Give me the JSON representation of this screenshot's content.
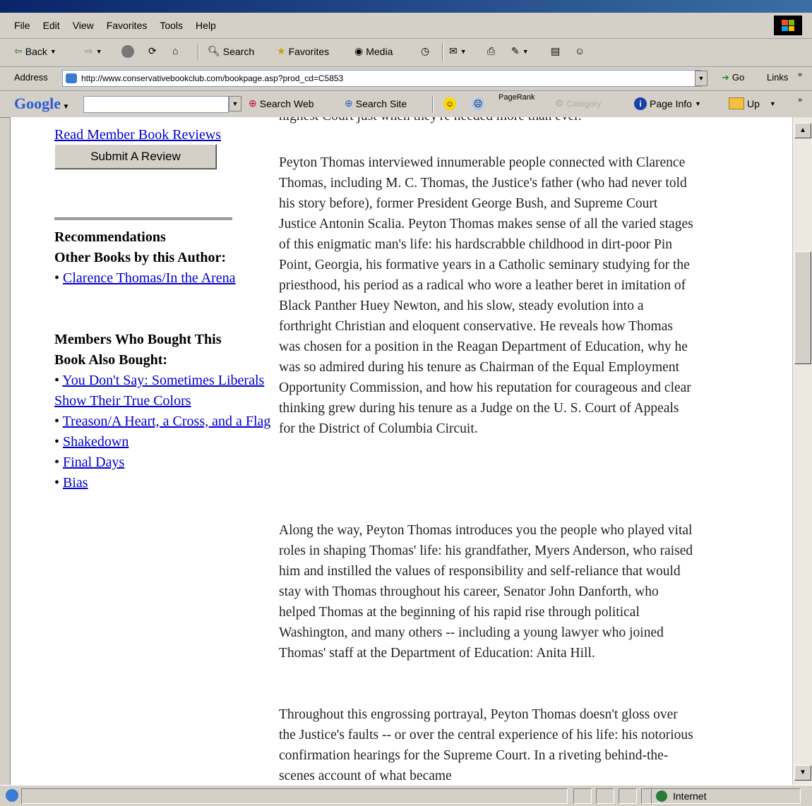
{
  "menu": [
    "File",
    "Edit",
    "View",
    "Favorites",
    "Tools",
    "Help"
  ],
  "toolbar": {
    "back": "Back",
    "search": "Search",
    "favorites": "Favorites",
    "media": "Media"
  },
  "address": {
    "label": "Address",
    "url": "http://www.conservativebookclub.com/bookpage.asp?prod_cd=C5853",
    "go": "Go",
    "links": "Links"
  },
  "google": {
    "logo": "Google",
    "search_web": "Search Web",
    "search_site": "Search Site",
    "pagerank": "PageRank",
    "category": "Category",
    "page_info": "Page Info",
    "up": "Up"
  },
  "sidebar": {
    "read_reviews": "Read Member Book Reviews",
    "submit_review": "Submit A Review",
    "recommendations": "Recommendations",
    "other_books_heading": "Other Books by this Author:",
    "other_books": [
      "Clarence Thomas/In the Arena"
    ],
    "also_bought_heading_1": "Members Who Bought This",
    "also_bought_heading_2": "Book Also Bought:",
    "also_bought": [
      "You Don't Say: Sometimes Liberals Show Their True Colors",
      "Treason/A Heart, a Cross, and a Flag",
      "Shakedown",
      "Final Days",
      "Bias"
    ]
  },
  "main": {
    "top_line": "highest Court just when they're needed more than ever.",
    "para1": "Peyton Thomas interviewed innumerable people connected with Clarence Thomas, including M. C. Thomas, the Justice's father (who had never told his story before), former President George Bush, and Supreme Court Justice Antonin Scalia. Peyton Thomas makes sense of all the varied stages of this enigmatic man's life: his hardscrabble childhood in dirt-poor Pin Point, Georgia, his formative years in a Catholic seminary studying for the priesthood, his period as a radical who wore a leather beret in imitation of Black Panther Huey Newton, and his slow, steady evolution into a forthright Christian and eloquent conservative. He reveals how Thomas was chosen for a position in the Reagan Department of Education, why he was so admired during his tenure as Chairman of the Equal Employment Opportunity Commission, and how his reputation for courageous and clear thinking grew during his tenure as a Judge on the U. S. Court of Appeals for the District of Columbia Circuit.",
    "para2": "Along the way, Peyton Thomas introduces you the people who played vital roles in shaping Thomas' life: his grandfather, Myers Anderson, who raised him and instilled the values of responsibility and self-reliance that would stay with Thomas throughout his career, Senator John Danforth, who helped Thomas at the beginning of his rapid rise through political Washington, and many others -- including a young lawyer who joined Thomas' staff at the Department of Education: Anita Hill.",
    "para3": "Throughout this engrossing portrayal, Peyton Thomas doesn't gloss over the Justice's faults -- or over the central experience of his life: his notorious confirmation hearings for the Supreme Court. In a riveting behind-the-scenes account of what became"
  },
  "status": {
    "zone": "Internet"
  }
}
